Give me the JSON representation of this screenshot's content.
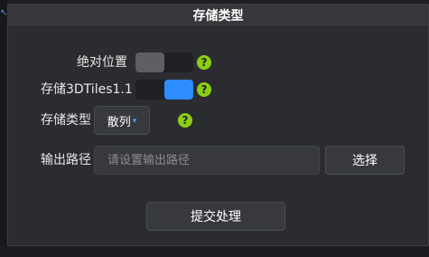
{
  "dialog": {
    "title": "存储类型"
  },
  "fields": {
    "absolute_position": {
      "label": "绝对位置",
      "enabled": false
    },
    "store_3dtiles_1_1": {
      "label": "存储3DTiles1.1",
      "enabled": true
    },
    "storage_type": {
      "label": "存储类型",
      "selected": "散列"
    },
    "output_path": {
      "label": "输出路径",
      "value": "",
      "placeholder": "请设置输出路径",
      "choose_button_label": "选择"
    }
  },
  "actions": {
    "submit_label": "提交处理"
  },
  "colors": {
    "help_icon": "#8ccf12",
    "toggle_on": "#2d8cff",
    "toggle_off": "#5d5f63"
  },
  "icons": {
    "help": "question-icon",
    "dropdown": "chevron-down-icon",
    "corner": "resize-arrow-icon"
  },
  "icon_glyphs": {
    "help": "?",
    "dropdown": "▾",
    "corner": "↖"
  }
}
